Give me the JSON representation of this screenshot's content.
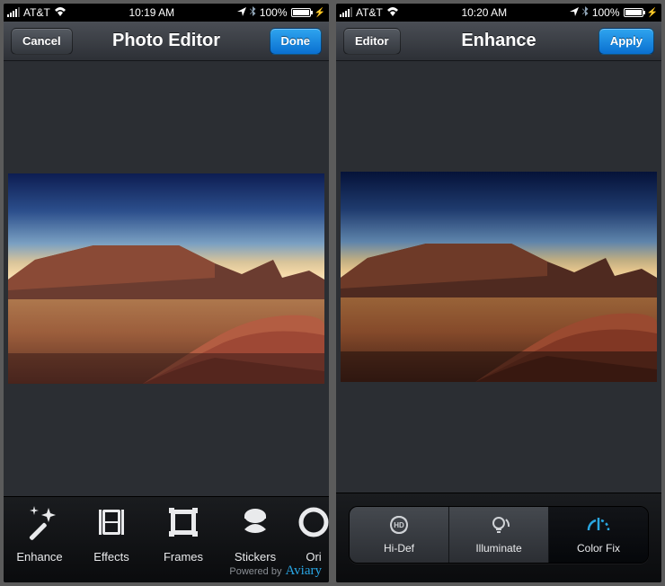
{
  "left": {
    "status": {
      "carrier": "AT&T",
      "time": "10:19 AM",
      "battery": "100%"
    },
    "nav": {
      "back": "Cancel",
      "title": "Photo Editor",
      "action": "Done"
    },
    "tools": [
      {
        "id": "enhance",
        "label": "Enhance"
      },
      {
        "id": "effects",
        "label": "Effects"
      },
      {
        "id": "frames",
        "label": "Frames"
      },
      {
        "id": "stickers",
        "label": "Stickers"
      },
      {
        "id": "orient",
        "label": "Ori"
      }
    ],
    "footer": {
      "powered": "Powered by",
      "brand": "Aviary"
    }
  },
  "right": {
    "status": {
      "carrier": "AT&T",
      "time": "10:20 AM",
      "battery": "100%"
    },
    "nav": {
      "back": "Editor",
      "title": "Enhance",
      "action": "Apply"
    },
    "segments": [
      {
        "id": "hidef",
        "label": "Hi-Def"
      },
      {
        "id": "illuminate",
        "label": "Illuminate"
      },
      {
        "id": "colorfix",
        "label": "Color Fix",
        "active": true
      }
    ]
  }
}
